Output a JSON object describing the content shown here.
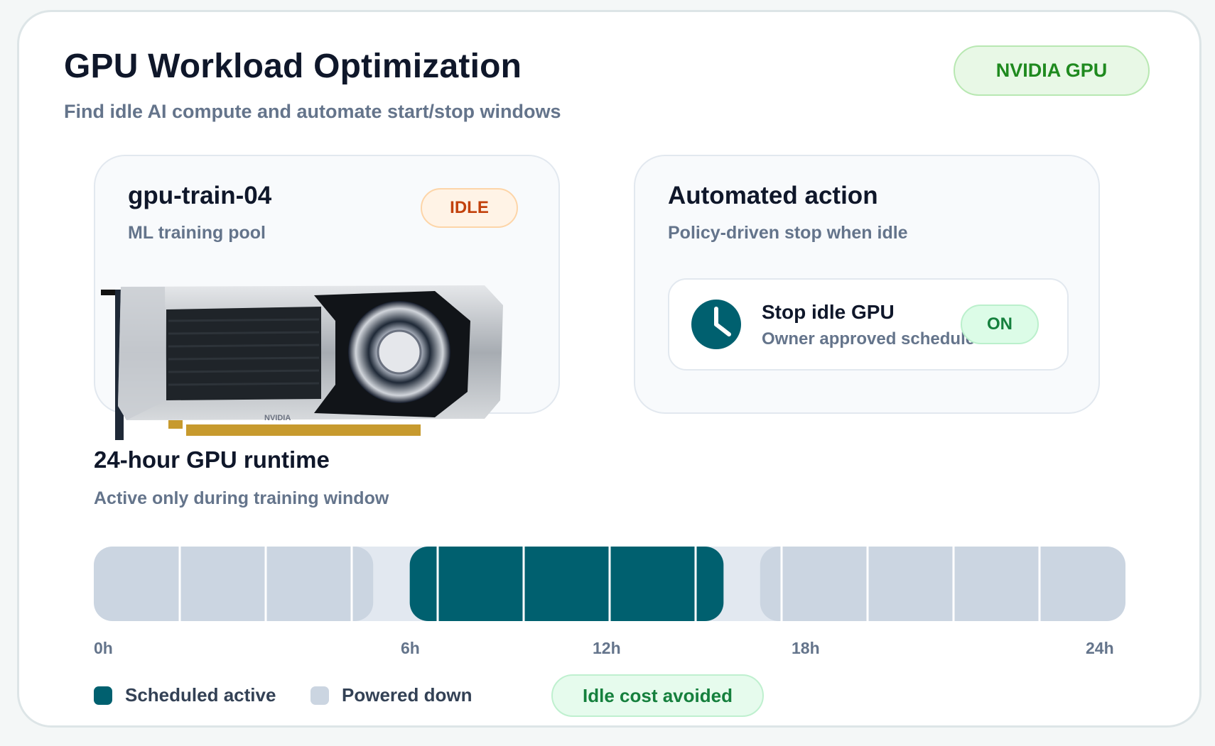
{
  "header": {
    "title": "GPU Workload Optimization",
    "subtitle": "Find idle AI compute and automate start/stop windows",
    "badge": "NVIDIA GPU"
  },
  "instance": {
    "name": "gpu-train-04",
    "pool": "ML training pool",
    "status": "IDLE",
    "image_brand": "NVIDIA"
  },
  "automation": {
    "title": "Automated action",
    "subtitle": "Policy-driven stop when idle",
    "rule_title": "Stop idle GPU",
    "rule_sub": "Owner approved schedule",
    "rule_state": "ON",
    "icon": "clock-icon"
  },
  "schedule": {
    "title": "24-hour GPU runtime",
    "subtitle": "Active only during training window",
    "ticks": [
      "0h",
      "6h",
      "12h",
      "18h",
      "24h"
    ],
    "legend": {
      "active": "Scheduled active",
      "down": "Powered down"
    },
    "savings": "Idle cost avoided"
  },
  "chart_data": {
    "type": "table",
    "x_range": [
      0,
      24
    ],
    "x_unit": "h",
    "segments": [
      {
        "state": "down",
        "start": 0,
        "end": 6.5
      },
      {
        "state": "active",
        "start": 7.35,
        "end": 14.65
      },
      {
        "state": "down",
        "start": 15.5,
        "end": 24
      }
    ]
  },
  "colors": {
    "active": "#00606f",
    "down": "#cbd5e1",
    "track": "#e2e8f0",
    "accent_green": "#15803d",
    "accent_orange": "#c2410c"
  }
}
